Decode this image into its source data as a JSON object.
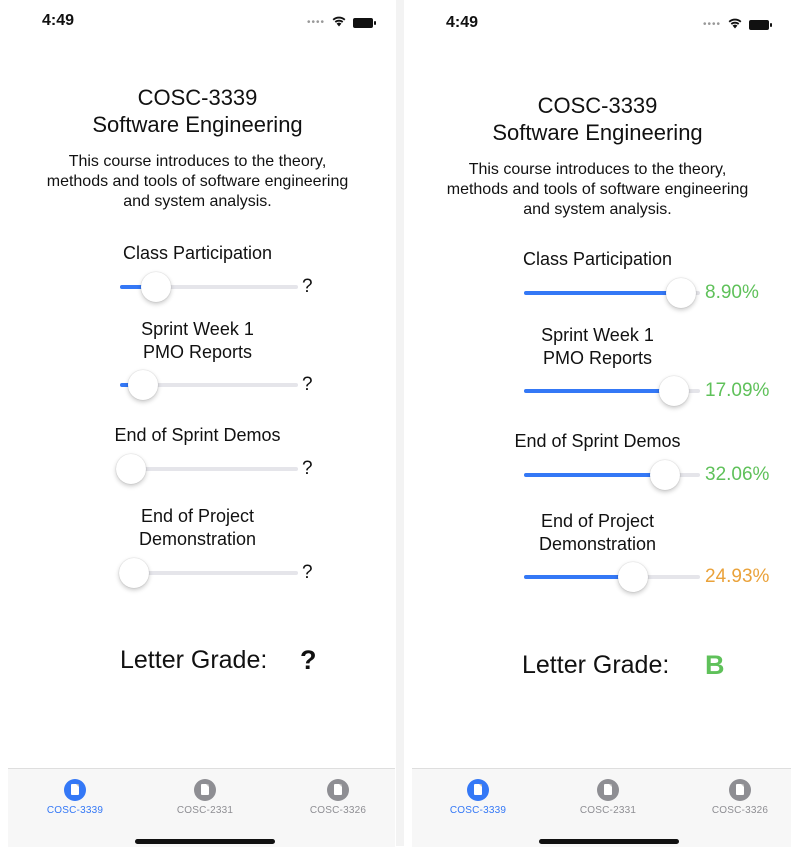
{
  "colors": {
    "accent": "#3478f6",
    "grade_green": "#5fc15a",
    "grade_orange": "#eaa23a",
    "track": "#e5e5ea",
    "tab_inactive": "#8e8e93"
  },
  "screens": [
    {
      "status_time": "4:49",
      "course_code": "COSC-3339",
      "course_name": "Software Engineering",
      "description_lines": [
        "This course introduces to the theory,",
        "methods and tools of software engineering",
        "and system analysis."
      ],
      "categories": [
        {
          "label_lines": [
            "Class Participation"
          ],
          "value": "?",
          "slider_level": 0.2,
          "value_color": "#111111"
        },
        {
          "label_lines": [
            "Sprint Week 1",
            "PMO Reports"
          ],
          "value": "?",
          "slider_level": 0.13,
          "value_color": "#111111"
        },
        {
          "label_lines": [
            "End of Sprint Demos"
          ],
          "value": "?",
          "slider_level": 0.06,
          "value_color": "#111111"
        },
        {
          "label_lines": [
            "End of Project",
            "Demonstration"
          ],
          "value": "?",
          "slider_level": 0.08,
          "value_color": "#111111"
        }
      ],
      "letter_grade_label": "Letter Grade:",
      "letter_grade": "?",
      "letter_grade_color": "#111111",
      "tabs": [
        {
          "label": "COSC-3339",
          "active": true,
          "icon": "document-icon"
        },
        {
          "label": "COSC-2331",
          "active": false,
          "icon": "document-icon"
        },
        {
          "label": "COSC-3326",
          "active": false,
          "icon": "document-icon"
        }
      ]
    },
    {
      "status_time": "4:49",
      "course_code": "COSC-3339",
      "course_name": "Software Engineering",
      "description_lines": [
        "This course introduces to the theory,",
        "methods and tools of software engineering",
        "and system analysis."
      ],
      "categories": [
        {
          "label_lines": [
            "Class Participation"
          ],
          "value": "8.90%",
          "slider_level": 0.89,
          "value_color": "#5fc15a"
        },
        {
          "label_lines": [
            "Sprint Week 1",
            "PMO Reports"
          ],
          "value": "17.09%",
          "slider_level": 0.85,
          "value_color": "#5fc15a"
        },
        {
          "label_lines": [
            "End of Sprint Demos"
          ],
          "value": "32.06%",
          "slider_level": 0.8,
          "value_color": "#5fc15a"
        },
        {
          "label_lines": [
            "End of Project",
            "Demonstration"
          ],
          "value": "24.93%",
          "slider_level": 0.62,
          "value_color": "#eaa23a"
        }
      ],
      "letter_grade_label": "Letter Grade:",
      "letter_grade": "B",
      "letter_grade_color": "#5fc15a",
      "tabs": [
        {
          "label": "COSC-3339",
          "active": true,
          "icon": "document-icon"
        },
        {
          "label": "COSC-2331",
          "active": false,
          "icon": "document-icon"
        },
        {
          "label": "COSC-3326",
          "active": false,
          "icon": "document-icon"
        }
      ]
    }
  ]
}
